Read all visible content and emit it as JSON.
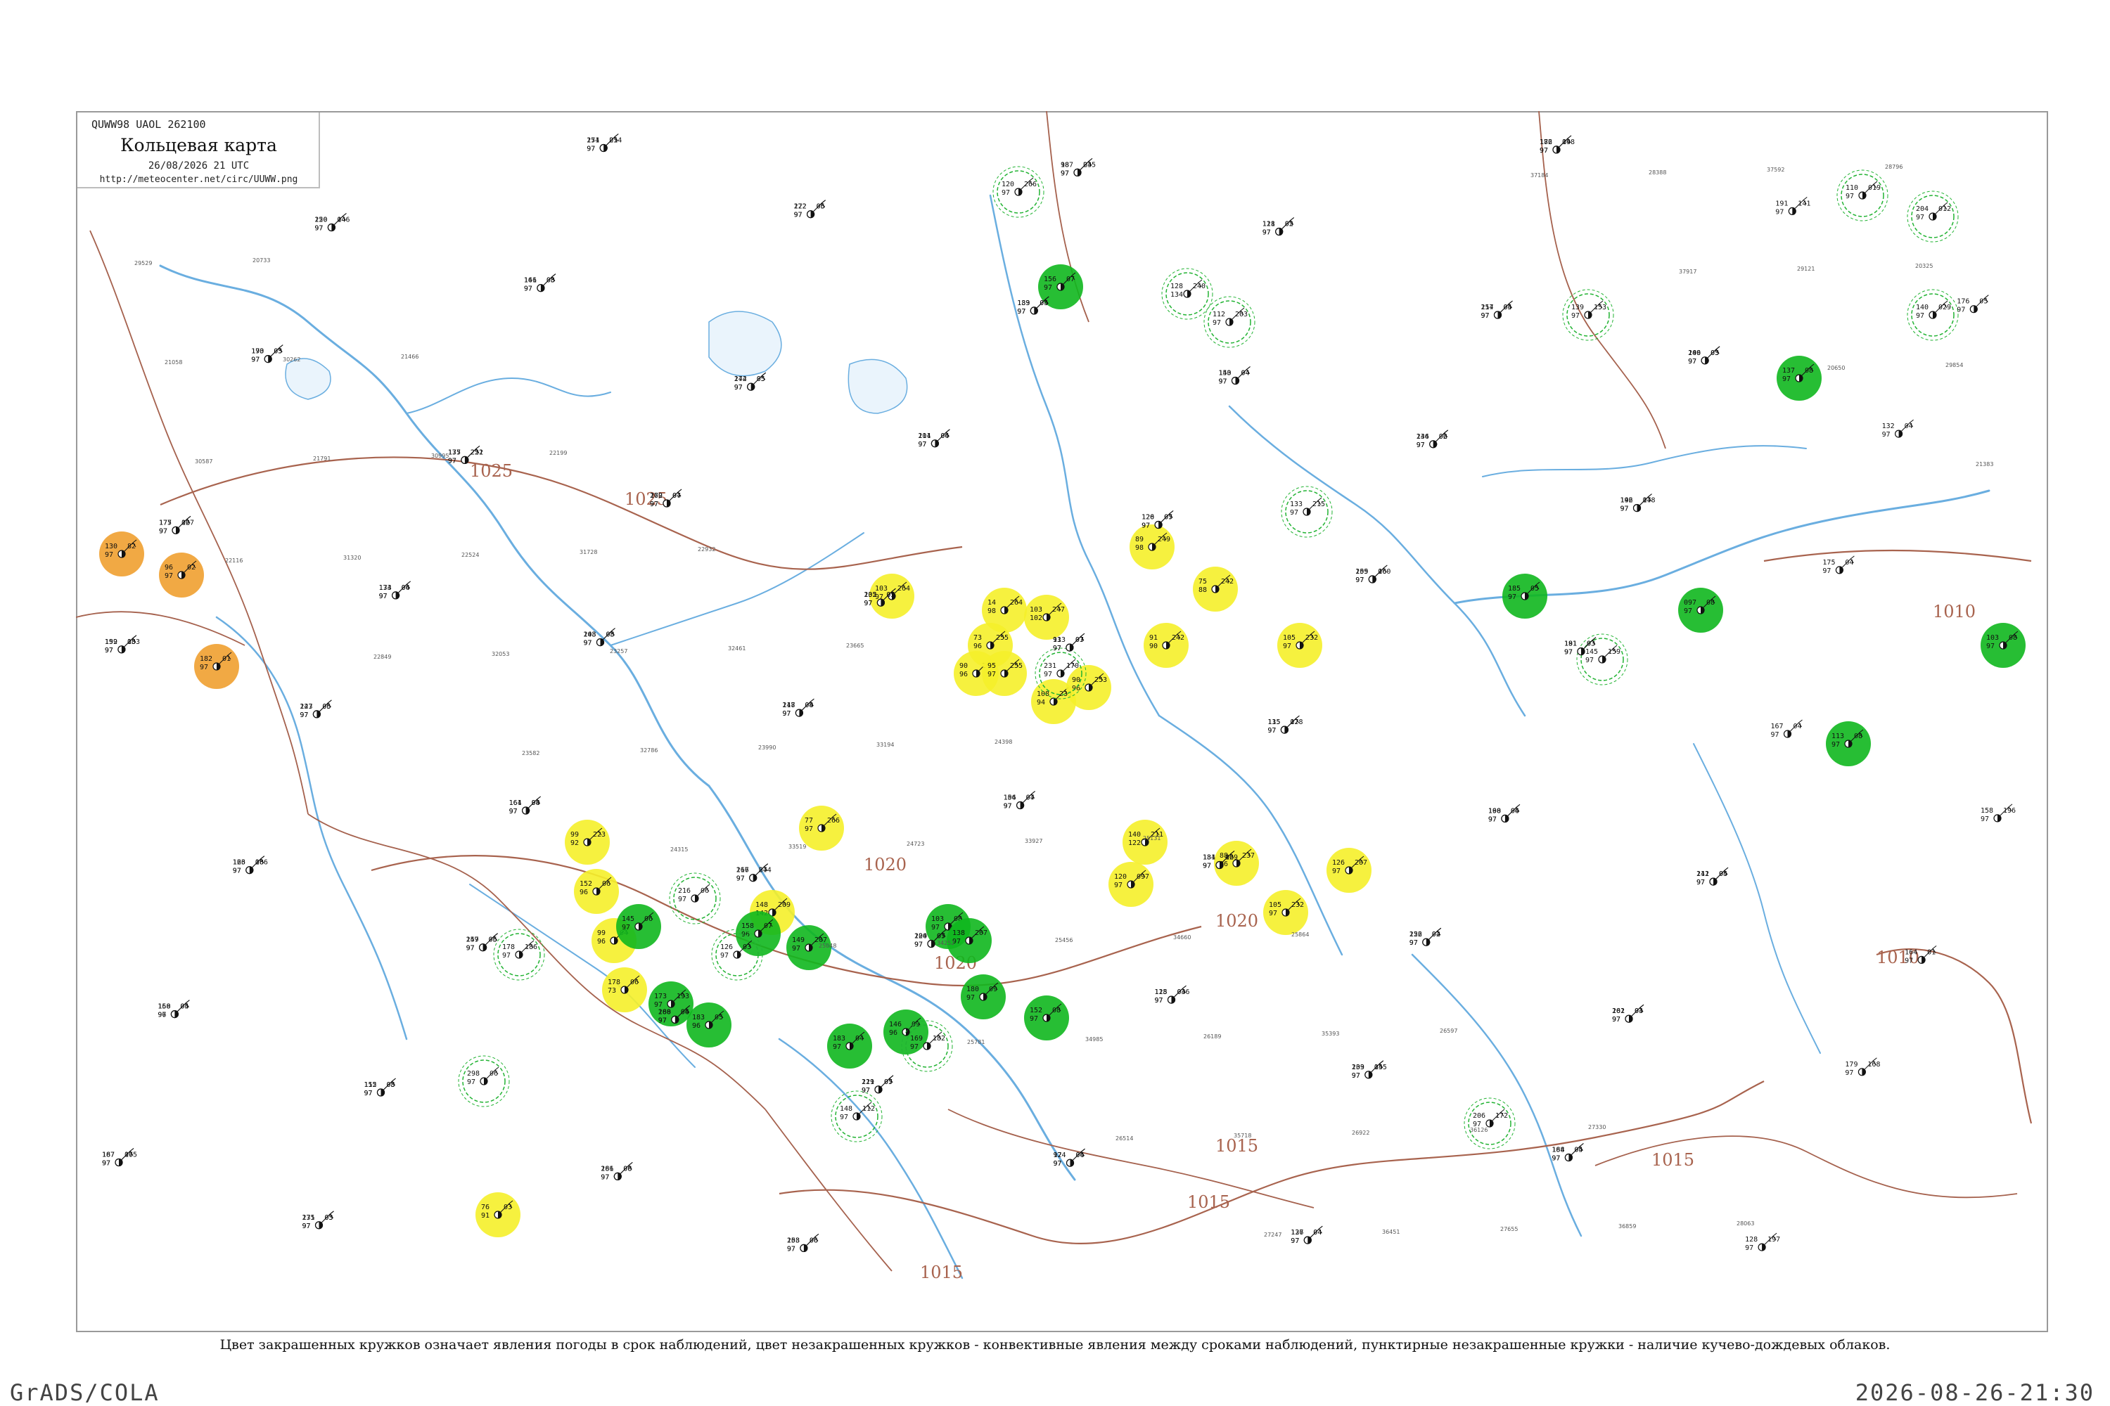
{
  "header": {
    "code": "QUWW98  UAOL  262100",
    "title": "Кольцевая карта",
    "date": "26/08/2026 21 UTC",
    "url": "http://meteocenter.net/circ/UUWW.png"
  },
  "caption": "Цвет закрашенных кружков означает явления погоды в срок наблюдений, цвет незакрашенных кружков - конвективные явления между сроками наблюдений, пунктирные незакрашенные кружки - наличие кучево-дождевых облаков.",
  "footer": {
    "left": "GrADS/COLA",
    "right": "2026-08-26-21:30"
  },
  "colors": {
    "frame": "#9a9a9a",
    "river": "#6aaee0",
    "isobar": "#a8634e",
    "orange_fill": "#f0a030",
    "yellow_fill": "#f5f02a",
    "green_fill": "#10b71e",
    "convective_ring": "#22b333",
    "station_text": "#111111"
  },
  "isobar_labels": [
    "1025",
    "1025",
    "1020",
    "1020",
    "1020",
    "1015",
    "1015",
    "1015",
    "1015",
    "1010",
    "1010"
  ],
  "stations": [
    {
      "t": "130",
      "p": "82",
      "v": "97",
      "wx": "orange"
    },
    {
      "t": "96",
      "p": "02",
      "v": "97",
      "wx": "orange"
    },
    {
      "t": "182",
      "p": "01",
      "v": "97",
      "wx": "orange"
    },
    {
      "t": "76",
      "p": "03",
      "v": "91",
      "wx": "yellow"
    },
    {
      "t": "99",
      "p": "223",
      "v": "92",
      "wx": "yellow"
    },
    {
      "t": "152",
      "p": "06",
      "v": "96",
      "wx": "yellow"
    },
    {
      "t": "99",
      "p": "04",
      "v": "96",
      "wx": "yellow"
    },
    {
      "t": "178",
      "p": "06",
      "v": "73",
      "wx": "yellow"
    },
    {
      "t": "148",
      "p": "209",
      "v": "142",
      "wx": "yellow"
    },
    {
      "t": "77",
      "p": "266",
      "v": "97",
      "wx": "yellow"
    },
    {
      "t": "103",
      "p": "264",
      "v": "97",
      "wx": "yellow"
    },
    {
      "t": "14",
      "p": "264",
      "v": "98",
      "wx": "yellow"
    },
    {
      "t": "90",
      "p": "263",
      "v": "96",
      "wx": "yellow"
    },
    {
      "t": "73",
      "p": "255",
      "v": "96",
      "wx": "yellow"
    },
    {
      "t": "95",
      "p": "255",
      "v": "97",
      "wx": "yellow"
    },
    {
      "t": "103",
      "p": "247",
      "v": "102",
      "wx": "yellow"
    },
    {
      "t": "108",
      "p": "235",
      "v": "94",
      "wx": "yellow"
    },
    {
      "t": "90",
      "p": "253",
      "v": "96",
      "wx": "yellow"
    },
    {
      "t": "89",
      "p": "249",
      "v": "98",
      "wx": "yellow"
    },
    {
      "t": "91",
      "p": "242",
      "v": "90",
      "wx": "yellow"
    },
    {
      "t": "75",
      "p": "242",
      "v": "88",
      "wx": "yellow"
    },
    {
      "t": "88",
      "p": "237",
      "v": "96",
      "wx": "yellow"
    },
    {
      "t": "105",
      "p": "232",
      "v": "97",
      "wx": "yellow"
    },
    {
      "t": "105",
      "p": "232",
      "v": "97",
      "wx": "yellow"
    },
    {
      "t": "126",
      "p": "207",
      "v": "97",
      "wx": "yellow"
    },
    {
      "t": "140",
      "p": "211",
      "v": "122",
      "wx": "yellow"
    },
    {
      "t": "120",
      "p": "097",
      "v": "97",
      "wx": "yellow"
    },
    {
      "t": "145",
      "p": "06",
      "v": "97",
      "wx": "green"
    },
    {
      "t": "173",
      "p": "193",
      "v": "97",
      "wx": "green"
    },
    {
      "t": "183",
      "p": "05",
      "v": "96",
      "wx": "green"
    },
    {
      "t": "158",
      "p": "07",
      "v": "96",
      "wx": "green"
    },
    {
      "t": "149",
      "p": "207",
      "v": "97",
      "wx": "green"
    },
    {
      "t": "183",
      "p": "04",
      "v": "97",
      "wx": "green"
    },
    {
      "t": "146",
      "p": "09",
      "v": "96",
      "wx": "green"
    },
    {
      "t": "103",
      "p": "08",
      "v": "97",
      "wx": "green"
    },
    {
      "t": "180",
      "p": "09",
      "v": "97",
      "wx": "green"
    },
    {
      "t": "138",
      "p": "207",
      "v": "97",
      "wx": "green"
    },
    {
      "t": "152",
      "p": "08",
      "v": "97",
      "wx": "green"
    },
    {
      "t": "156",
      "p": "07",
      "v": "97",
      "wx": "green"
    },
    {
      "t": "185",
      "p": "05",
      "v": "97",
      "wx": "green"
    },
    {
      "t": "097",
      "p": "08",
      "v": "97",
      "wx": "green"
    },
    {
      "t": "103",
      "p": "08",
      "v": "97",
      "wx": "green"
    },
    {
      "t": "113",
      "p": "08",
      "v": "97",
      "wx": "green"
    },
    {
      "t": "137",
      "p": "08",
      "v": "97",
      "wx": "green"
    },
    {
      "t": "178",
      "p": "186",
      "v": "97",
      "wx": "ring"
    },
    {
      "t": "298",
      "p": "06",
      "v": "97",
      "wx": "ring"
    },
    {
      "t": "216",
      "p": "06",
      "v": "97",
      "wx": "ring"
    },
    {
      "t": "126",
      "p": "03",
      "v": "97",
      "wx": "ring"
    },
    {
      "t": "120",
      "p": "266",
      "v": "97",
      "wx": "ring"
    },
    {
      "t": "128",
      "p": "240",
      "v": "134",
      "wx": "ring"
    },
    {
      "t": "112",
      "p": "203",
      "v": "97",
      "wx": "ring"
    },
    {
      "t": "133",
      "p": "215",
      "v": "97",
      "wx": "ring"
    },
    {
      "t": "206",
      "p": "172",
      "v": "97",
      "wx": "ring"
    },
    {
      "t": "110",
      "p": "019",
      "v": "97",
      "wx": "ring"
    },
    {
      "t": "204",
      "p": "012",
      "v": "97",
      "wx": "ring"
    },
    {
      "t": "140",
      "p": "029",
      "v": "97",
      "wx": "ring"
    },
    {
      "t": "139",
      "p": "153",
      "v": "97",
      "wx": "ring"
    },
    {
      "t": "145",
      "p": "159",
      "v": "97",
      "wx": "ring"
    },
    {
      "t": "148",
      "p": "112",
      "v": "97",
      "wx": "ring"
    },
    {
      "t": "169",
      "p": "182",
      "v": "97",
      "wx": "ring"
    },
    {
      "t": "231",
      "p": "170",
      "v": "97",
      "wx": "ring"
    },
    {
      "t": "192",
      "p": "183",
      "v": "97",
      "wx": "none"
    },
    {
      "t": "167",
      "p": "06",
      "v": "97",
      "wx": "none"
    },
    {
      "t": "175",
      "p": "167",
      "v": "97",
      "wx": "none"
    },
    {
      "t": "150",
      "p": "04",
      "v": "96",
      "wx": "none"
    },
    {
      "t": "193",
      "p": "05",
      "v": "97",
      "wx": "none"
    },
    {
      "t": "163",
      "p": "06",
      "v": "97",
      "wx": "none"
    },
    {
      "t": "220",
      "p": "146",
      "v": "97",
      "wx": "none"
    },
    {
      "t": "223",
      "p": "06",
      "v": "97",
      "wx": "none"
    },
    {
      "t": "271",
      "p": "03",
      "v": "97",
      "wx": "none"
    },
    {
      "t": "173",
      "p": "06",
      "v": "97",
      "wx": "none"
    },
    {
      "t": "155",
      "p": "05",
      "v": "97",
      "wx": "none"
    },
    {
      "t": "175",
      "p": "252",
      "v": "97",
      "wx": "none"
    },
    {
      "t": "259",
      "p": "06",
      "v": "97",
      "wx": "none"
    },
    {
      "t": "146",
      "p": "08",
      "v": "97",
      "wx": "none"
    },
    {
      "t": "161",
      "p": "98",
      "v": "97",
      "wx": "none"
    },
    {
      "t": "254",
      "p": "05",
      "v": "97",
      "wx": "none"
    },
    {
      "t": "143",
      "p": "08",
      "v": "97",
      "wx": "none"
    },
    {
      "t": "281",
      "p": "06",
      "v": "97",
      "wx": "none"
    },
    {
      "t": "279",
      "p": "04",
      "v": "97",
      "wx": "none"
    },
    {
      "t": "280",
      "p": "06",
      "v": "97",
      "wx": "none"
    },
    {
      "t": "274",
      "p": "05",
      "v": "97",
      "wx": "none"
    },
    {
      "t": "267",
      "p": "04",
      "v": "97",
      "wx": "none"
    },
    {
      "t": "272",
      "p": "06",
      "v": "97",
      "wx": "none"
    },
    {
      "t": "247",
      "p": "08",
      "v": "97",
      "wx": "none"
    },
    {
      "t": "253",
      "p": "06",
      "v": "97",
      "wx": "none"
    },
    {
      "t": "235",
      "p": "05",
      "v": "97",
      "wx": "none"
    },
    {
      "t": "221",
      "p": "07",
      "v": "97",
      "wx": "none"
    },
    {
      "t": "204",
      "p": "04",
      "v": "97",
      "wx": "none"
    },
    {
      "t": "200",
      "p": "05",
      "v": "97",
      "wx": "none"
    },
    {
      "t": "189",
      "p": "04",
      "v": "97",
      "wx": "none"
    },
    {
      "t": "154",
      "p": "07",
      "v": "97",
      "wx": "none"
    },
    {
      "t": "187",
      "p": "04",
      "v": "97",
      "wx": "none"
    },
    {
      "t": "113",
      "p": "03",
      "v": "97",
      "wx": "none"
    },
    {
      "t": "124",
      "p": "04",
      "v": "97",
      "wx": "none"
    },
    {
      "t": "126",
      "p": "07",
      "v": "97",
      "wx": "none"
    },
    {
      "t": "118",
      "p": "046",
      "v": "97",
      "wx": "none"
    },
    {
      "t": "150",
      "p": "04",
      "v": "97",
      "wx": "none"
    },
    {
      "t": "184",
      "p": "129",
      "v": "97",
      "wx": "none"
    },
    {
      "t": "121",
      "p": "02",
      "v": "97",
      "wx": "none"
    },
    {
      "t": "135",
      "p": "128",
      "v": "97",
      "wx": "none"
    },
    {
      "t": "136",
      "p": "04",
      "v": "97",
      "wx": "none"
    },
    {
      "t": "255",
      "p": "160",
      "v": "97",
      "wx": "none"
    },
    {
      "t": "203",
      "p": "145",
      "v": "97",
      "wx": "none"
    },
    {
      "t": "236",
      "p": "02",
      "v": "97",
      "wx": "none"
    },
    {
      "t": "226",
      "p": "02",
      "v": "97",
      "wx": "none"
    },
    {
      "t": "214",
      "p": "04",
      "v": "97",
      "wx": "none"
    },
    {
      "t": "198",
      "p": "04",
      "v": "97",
      "wx": "none"
    },
    {
      "t": "186",
      "p": "198",
      "v": "97",
      "wx": "none"
    },
    {
      "t": "191",
      "p": "03",
      "v": "97",
      "wx": "none"
    },
    {
      "t": "164",
      "p": "04",
      "v": "97",
      "wx": "none"
    },
    {
      "t": "142",
      "p": "178",
      "v": "97",
      "wx": "none"
    },
    {
      "t": "162",
      "p": "04",
      "v": "97",
      "wx": "none"
    },
    {
      "t": "146",
      "p": "03",
      "v": "97",
      "wx": "none"
    },
    {
      "t": "141",
      "p": "05",
      "v": "97",
      "wx": "none"
    },
    {
      "t": "191",
      "p": "141",
      "v": "97",
      "wx": "none"
    },
    {
      "t": "167",
      "p": "04",
      "v": "97",
      "wx": "none"
    },
    {
      "t": "128",
      "p": "197",
      "v": "97",
      "wx": "none"
    },
    {
      "t": "175",
      "p": "04",
      "v": "97",
      "wx": "none"
    },
    {
      "t": "179",
      "p": "168",
      "v": "97",
      "wx": "none"
    },
    {
      "t": "132",
      "p": "04",
      "v": "97",
      "wx": "none"
    },
    {
      "t": "164",
      "p": "01",
      "v": "97",
      "wx": "none"
    },
    {
      "t": "176",
      "p": "05",
      "v": "97",
      "wx": "none"
    },
    {
      "t": "158",
      "p": "196",
      "v": "97",
      "wx": "none"
    },
    {
      "t": "159",
      "p": "05",
      "v": "97",
      "wx": "none"
    },
    {
      "t": "187",
      "p": "175",
      "v": "97",
      "wx": "none"
    },
    {
      "t": "177",
      "p": "02",
      "v": "97",
      "wx": "none"
    },
    {
      "t": "168",
      "p": "05",
      "v": "97",
      "wx": "none"
    },
    {
      "t": "170",
      "p": "03",
      "v": "97",
      "wx": "none"
    },
    {
      "t": "126",
      "p": "186",
      "v": "97",
      "wx": "none"
    },
    {
      "t": "150",
      "p": "04",
      "v": "97",
      "wx": "none"
    },
    {
      "t": "147",
      "p": "05",
      "v": "97",
      "wx": "none"
    },
    {
      "t": "135",
      "p": "05",
      "v": "97",
      "wx": "none"
    },
    {
      "t": "134",
      "p": "04",
      "v": "97",
      "wx": "none"
    },
    {
      "t": "112",
      "p": "08",
      "v": "97",
      "wx": "none"
    },
    {
      "t": "137",
      "p": "221",
      "v": "97",
      "wx": "none"
    },
    {
      "t": "147",
      "p": "05",
      "v": "97",
      "wx": "none"
    },
    {
      "t": "161",
      "p": "05",
      "v": "97",
      "wx": "none"
    },
    {
      "t": "164",
      "p": "04",
      "v": "97",
      "wx": "none"
    },
    {
      "t": "171",
      "p": "214",
      "v": "97",
      "wx": "none"
    },
    {
      "t": "208",
      "p": "05",
      "v": "97",
      "wx": "none"
    },
    {
      "t": "166",
      "p": "08",
      "v": "97",
      "wx": "none"
    },
    {
      "t": "162",
      "p": "07",
      "v": "97",
      "wx": "none"
    },
    {
      "t": "168",
      "p": "04",
      "v": "97",
      "wx": "none"
    },
    {
      "t": "142",
      "p": "05",
      "v": "97",
      "wx": "none"
    },
    {
      "t": "116",
      "p": "274",
      "v": "97",
      "wx": "none"
    },
    {
      "t": "122",
      "p": "05",
      "v": "97",
      "wx": "none"
    },
    {
      "t": "118",
      "p": "04",
      "v": "97",
      "wx": "none"
    },
    {
      "t": "108",
      "p": "06",
      "v": "97",
      "wx": "none"
    },
    {
      "t": "102",
      "p": "07",
      "v": "97",
      "wx": "none"
    },
    {
      "t": "119",
      "p": "05",
      "v": "97",
      "wx": "none"
    },
    {
      "t": "111",
      "p": "06",
      "v": "97",
      "wx": "none"
    },
    {
      "t": "124",
      "p": "07",
      "v": "97",
      "wx": "none"
    },
    {
      "t": "133",
      "p": "05",
      "v": "97",
      "wx": "none"
    },
    {
      "t": "106",
      "p": "04",
      "v": "97",
      "wx": "none"
    },
    {
      "t": "98",
      "p": "235",
      "v": "97",
      "wx": "none"
    },
    {
      "t": "93",
      "p": "07",
      "v": "97",
      "wx": "none"
    },
    {
      "t": "97",
      "p": "06",
      "v": "97",
      "wx": "none"
    },
    {
      "t": "120",
      "p": "05",
      "v": "97",
      "wx": "none"
    },
    {
      "t": "125",
      "p": "03",
      "v": "97",
      "wx": "none"
    },
    {
      "t": "143",
      "p": "04",
      "v": "97",
      "wx": "none"
    },
    {
      "t": "131",
      "p": "06",
      "v": "97",
      "wx": "none"
    },
    {
      "t": "118",
      "p": "05",
      "v": "97",
      "wx": "none"
    },
    {
      "t": "115",
      "p": "07",
      "v": "97",
      "wx": "none"
    },
    {
      "t": "127",
      "p": "04",
      "v": "97",
      "wx": "none"
    },
    {
      "t": "109",
      "p": "06",
      "v": "97",
      "wx": "none"
    },
    {
      "t": "139",
      "p": "05",
      "v": "97",
      "wx": "none"
    },
    {
      "t": "144",
      "p": "06",
      "v": "97",
      "wx": "none"
    },
    {
      "t": "152",
      "p": "04",
      "v": "97",
      "wx": "none"
    },
    {
      "t": "157",
      "p": "05",
      "v": "97",
      "wx": "none"
    },
    {
      "t": "160",
      "p": "06",
      "v": "97",
      "wx": "none"
    },
    {
      "t": "172",
      "p": "04",
      "v": "97",
      "wx": "none"
    },
    {
      "t": "181",
      "p": "03",
      "v": "97",
      "wx": "none"
    },
    {
      "t": "188",
      "p": "05",
      "v": "97",
      "wx": "none"
    },
    {
      "t": "196",
      "p": "04",
      "v": "97",
      "wx": "none"
    },
    {
      "t": "201",
      "p": "03",
      "v": "97",
      "wx": "none"
    },
    {
      "t": "209",
      "p": "05",
      "v": "97",
      "wx": "none"
    },
    {
      "t": "212",
      "p": "04",
      "v": "97",
      "wx": "none"
    }
  ]
}
